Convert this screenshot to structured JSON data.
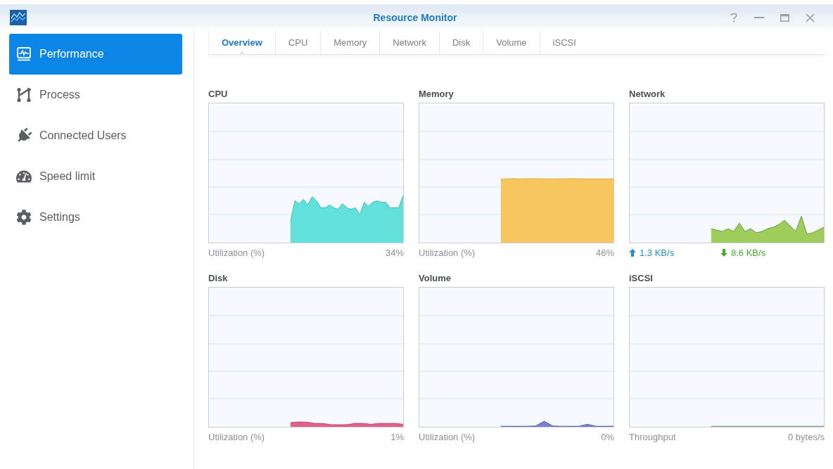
{
  "window": {
    "title": "Resource Monitor"
  },
  "sidebar": {
    "items": [
      {
        "label": "Performance",
        "selected": true
      },
      {
        "label": "Process",
        "selected": false
      },
      {
        "label": "Connected Users",
        "selected": false
      },
      {
        "label": "Speed limit",
        "selected": false
      },
      {
        "label": "Settings",
        "selected": false
      }
    ]
  },
  "tabs": [
    {
      "label": "Overview",
      "selected": true
    },
    {
      "label": "CPU",
      "selected": false
    },
    {
      "label": "Memory",
      "selected": false
    },
    {
      "label": "Network",
      "selected": false
    },
    {
      "label": "Disk",
      "selected": false
    },
    {
      "label": "Volume",
      "selected": false
    },
    {
      "label": "iSCSI",
      "selected": false
    }
  ],
  "panels": [
    {
      "title": "CPU",
      "kind": "utilization",
      "color": "#62e0dc",
      "footer_label": "Utilization (%)",
      "footer_value": "34%"
    },
    {
      "title": "Memory",
      "kind": "utilization",
      "color": "#f6c65c",
      "footer_label": "Utilization (%)",
      "footer_value": "46%"
    },
    {
      "title": "Network",
      "kind": "traffic",
      "color": "#9fcd5c",
      "upload": "1.3 KB/s",
      "download": "8.6 KB/s"
    },
    {
      "title": "Disk",
      "kind": "utilization",
      "color": "#e0628c",
      "footer_label": "Utilization (%)",
      "footer_value": "1%"
    },
    {
      "title": "Volume",
      "kind": "utilization",
      "color": "#7e7fd2",
      "footer_label": "Utilization (%)",
      "footer_value": "0%"
    },
    {
      "title": "iSCSI",
      "kind": "utilization",
      "color": "#9aa3ad",
      "footer_label": "Throughput",
      "footer_value": "0 bytes/s"
    }
  ]
}
